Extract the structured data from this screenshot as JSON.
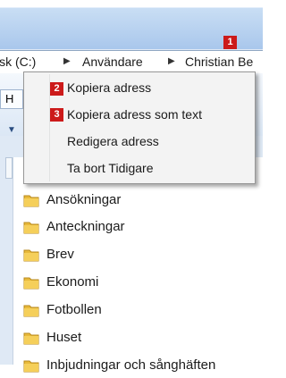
{
  "address_bar": {
    "segments": [
      "isk (C:)",
      "Användare",
      "Christian Be"
    ]
  },
  "toolbar": {
    "tab_letter": "H",
    "dropdown_glyph": "▼"
  },
  "context_menu": {
    "items": [
      {
        "label": "Kopiera adress",
        "badge": "2"
      },
      {
        "label": "Kopiera adress som text",
        "badge": "3"
      },
      {
        "label": "Redigera adress"
      },
      {
        "label": "Ta bort Tidigare"
      }
    ]
  },
  "callout_badge": "1",
  "folders": [
    "Ansökningar",
    "Anteckningar",
    "Brev",
    "Ekonomi",
    "Fotbollen",
    "Huset",
    "Inbjudningar och sånghäften"
  ],
  "colors": {
    "badge": "#cc1a1a",
    "folder": "#e8b93a"
  },
  "icons": {
    "folder": "folder-icon",
    "address_separator": "chevron-right-icon"
  }
}
